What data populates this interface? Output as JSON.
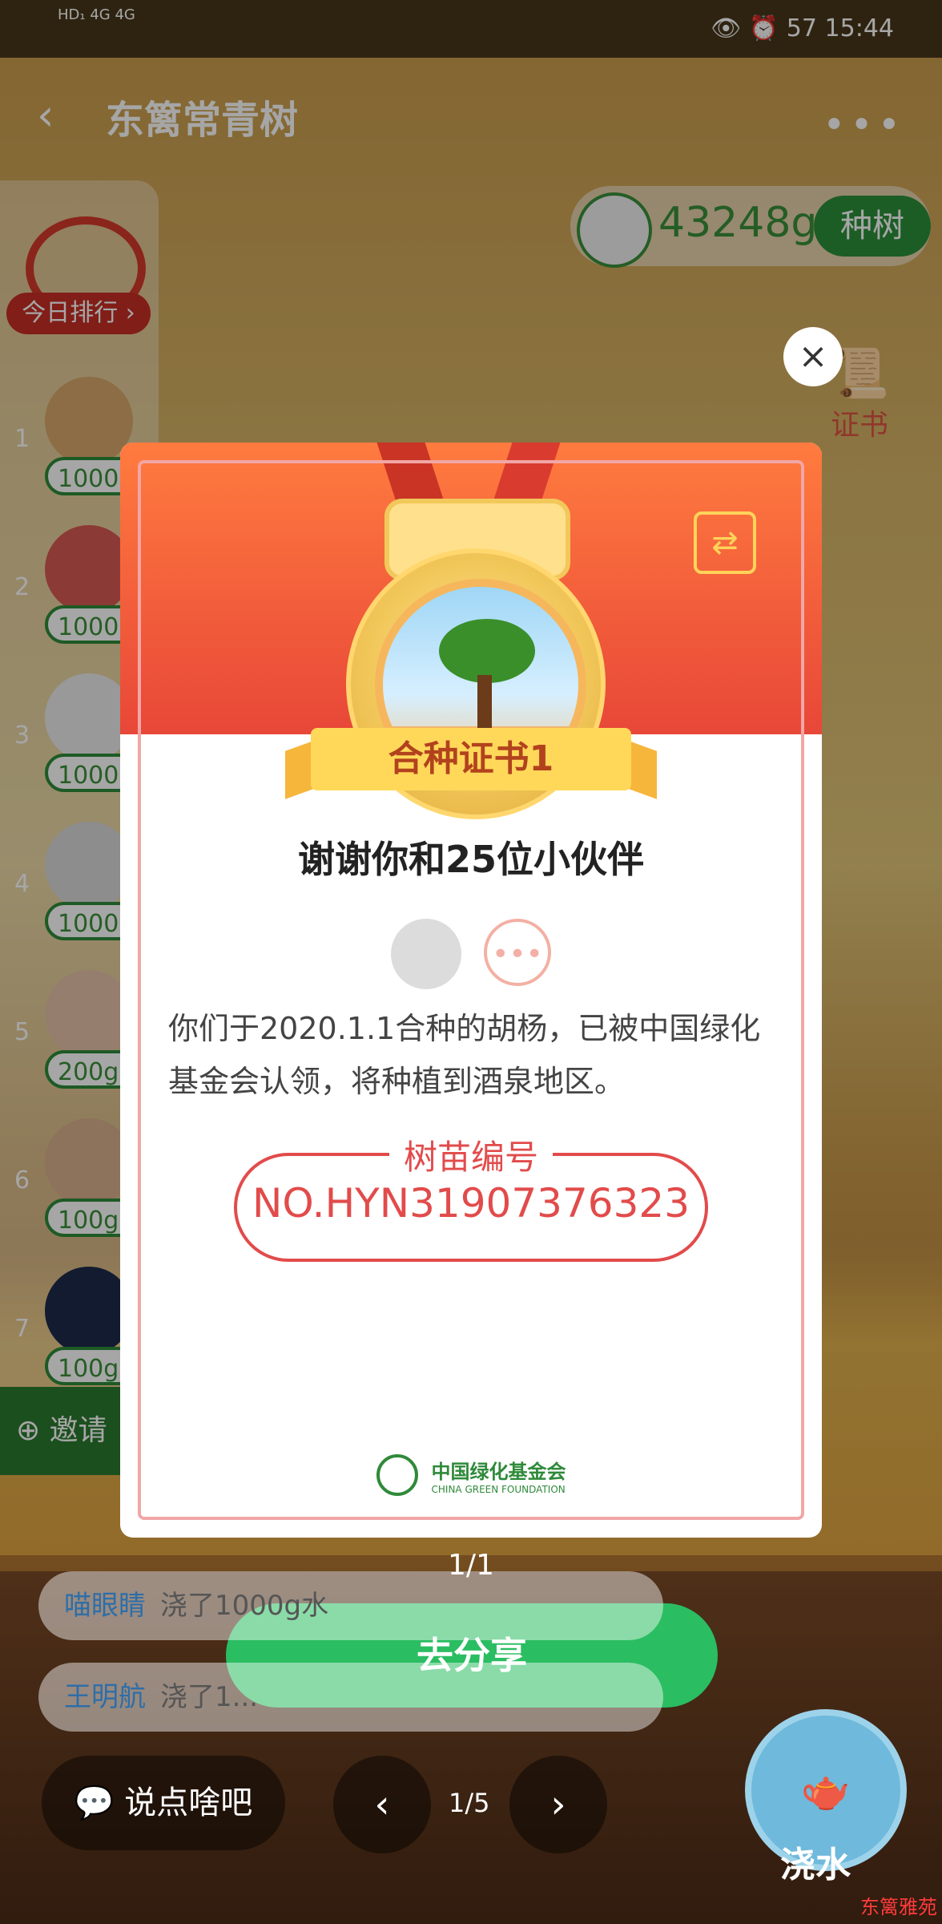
{
  "status_bar": {
    "left": "HD₁ 4G 4G",
    "time": "15:44",
    "battery": "57"
  },
  "header": {
    "back_icon": "‹",
    "title": "东篱常青树",
    "more_icon": "•••"
  },
  "left_panel": {
    "rank_button": "今日排行 ›",
    "items": [
      {
        "rank": "1",
        "value": "1000g"
      },
      {
        "rank": "2",
        "value": "1000g"
      },
      {
        "rank": "3",
        "value": "1000g"
      },
      {
        "rank": "4",
        "value": "1000g"
      },
      {
        "rank": "5",
        "value": "200g"
      },
      {
        "rank": "6",
        "value": "100g"
      },
      {
        "rank": "7",
        "value": "100g"
      }
    ],
    "invite": "邀请"
  },
  "top_right": {
    "score": "43248g",
    "plant_button": "种树",
    "certificate_label": "证书"
  },
  "modal": {
    "close_icon": "×",
    "medal_title": "合种证书1",
    "switch_icon": "⇄",
    "thanks_text": "谢谢你和25位小伙伴",
    "more_dots": "•••",
    "description": "你们于2020.1.1合种的胡杨，已被中国绿化基金会认领，将种植到酒泉地区。",
    "code_label": "树苗编号",
    "code_value": "NO.HYN31907376323",
    "foundation_cn": "中国绿化基金会",
    "foundation_en": "CHINA GREEN FOUNDATION"
  },
  "pager": "1/1",
  "share_button": "去分享",
  "messages": [
    {
      "user": "喵眼睛",
      "text": "浇了1000g水"
    },
    {
      "user": "王明航",
      "text": "浇了1..."
    }
  ],
  "bottom_bar": {
    "chat_placeholder": "说点啥吧",
    "page": "1/5",
    "prev": "‹",
    "next": "›",
    "water_label": "浇水"
  },
  "watermark": "东篱雅苑"
}
